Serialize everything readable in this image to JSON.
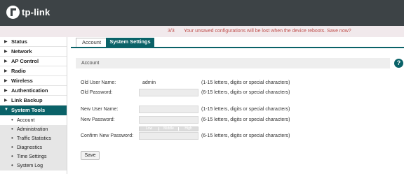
{
  "brand": {
    "name": "tp-link"
  },
  "notice": {
    "count": "3/3",
    "message": "Your unsaved configurations will be lost when the device reboots. Save now?"
  },
  "sidebar": {
    "items": [
      {
        "label": "Status"
      },
      {
        "label": "Network"
      },
      {
        "label": "AP Control"
      },
      {
        "label": "Radio"
      },
      {
        "label": "Wireless"
      },
      {
        "label": "Authentication"
      },
      {
        "label": "Link Backup"
      },
      {
        "label": "System Tools"
      }
    ],
    "subitems": [
      {
        "label": "Account"
      },
      {
        "label": "Administration"
      },
      {
        "label": "Traffic Statistics"
      },
      {
        "label": "Diagnostics"
      },
      {
        "label": "Time Settings"
      },
      {
        "label": "System Log"
      }
    ]
  },
  "tabs": {
    "account": "Account",
    "system_settings": "System Settings"
  },
  "panel": {
    "title": "Account"
  },
  "form": {
    "old_user_label": "Old User Name:",
    "old_user_value": "admin",
    "old_user_hint": "(1-15 letters, digits or special characters)",
    "old_password_label": "Old Password:",
    "old_password_hint": "(6-15 letters, digits or special characters)",
    "new_user_label": "New User Name:",
    "new_user_hint": "(1-15 letters, digits or special characters)",
    "new_password_label": "New Password:",
    "new_password_hint": "(6-15 letters, digits or special characters)",
    "strength": [
      "Low",
      "Middle",
      "High"
    ],
    "confirm_label": "Confirm New Password:",
    "confirm_hint": "(6-15 letters, digits or special characters)",
    "save_label": "Save"
  },
  "colors": {
    "header": "#3d4346",
    "accent": "#0a6268",
    "notice_text": "#c0504d",
    "notice_bg": "#f1e9ec"
  },
  "icons": {
    "logo": "tp-link-logo-icon",
    "help": "help-icon",
    "nav_arrow": "triangle-right-icon",
    "nav_arrow_open": "triangle-down-icon",
    "sub_bullet": "bullet-icon"
  }
}
